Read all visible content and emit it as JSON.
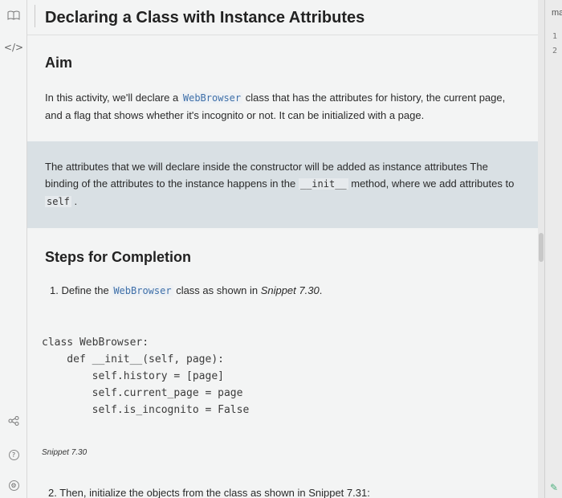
{
  "header": {
    "title": "Declaring a Class with Instance Attributes"
  },
  "sidebar": {
    "icons": [
      "book-icon",
      "code-icon",
      "share-icon",
      "help-icon",
      "settings-icon"
    ],
    "code_glyph": "</>"
  },
  "aim": {
    "heading": "Aim",
    "paragraph": {
      "before": "In this activity, we'll declare a ",
      "code": "WebBrowser",
      "after": " class that has the attributes for history, the current page, and a flag that shows whether it's incognito or not. It can be initialized with a page."
    }
  },
  "callout": {
    "part1": "The attributes that we will declare inside the constructor will be added as instance attributes The binding of the attributes to the instance happens in the ",
    "code1": "__init__",
    "part2": " method, where we add attributes to ",
    "code2": "self",
    "part3": " ."
  },
  "steps": {
    "heading": "Steps for Completion",
    "step1": {
      "prefix": "1. Define the ",
      "code": "WebBrowser",
      "middle": " class as shown in ",
      "ref": "Snippet 7.30",
      "suffix": "."
    },
    "snippet": {
      "lines": [
        "class WebBrowser:",
        "    def __init__(self, page):",
        "        self.history = [page]",
        "        self.current_page = page",
        "        self.is_incognito = False"
      ],
      "caption": "Snippet 7.30"
    },
    "step2": "2. Then, initialize the objects from the class as shown in Snippet 7.31:"
  },
  "right_panel": {
    "tab_label": "ma",
    "line_numbers": [
      "1",
      "2"
    ]
  }
}
